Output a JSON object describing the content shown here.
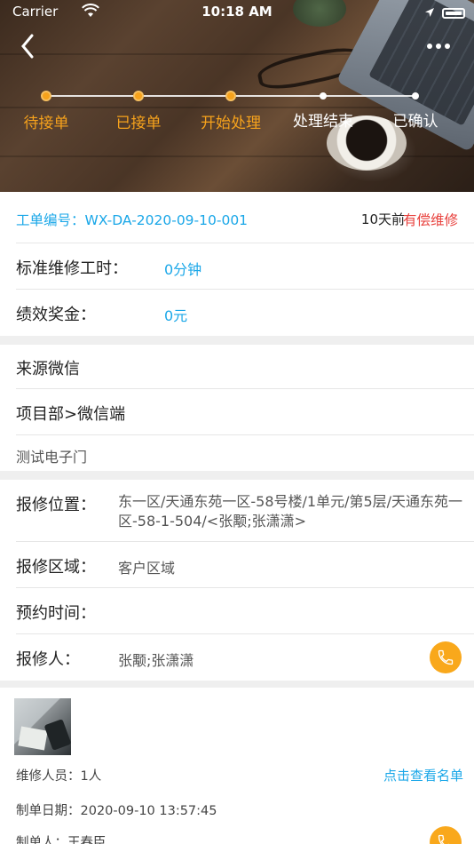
{
  "status_bar": {
    "carrier": "Carrier",
    "time": "10:18 AM"
  },
  "steps": [
    {
      "label": "待接单",
      "done": true
    },
    {
      "label": "已接单",
      "done": true
    },
    {
      "label": "开始处理",
      "done": true
    },
    {
      "label": "处理结束",
      "done": false
    },
    {
      "label": "已确认",
      "done": false
    }
  ],
  "order": {
    "number": "工单编号：WX-DA-2020-09-10-001",
    "ago": "10天前",
    "type": "有偿维修",
    "std_time_label": "标准维修工时：",
    "std_time_value": "0分钟",
    "bonus_label": "绩效奖金：",
    "bonus_value": "0元"
  },
  "source": {
    "channel": "来源微信",
    "dept": "项目部>微信端",
    "desc": "测试电子门"
  },
  "details": {
    "location_label": "报修位置：",
    "location_value": "东一区/天通东苑一区-58号楼/1单元/第5层/天通东苑一区-58-1-504/<张颙;张潇潇>",
    "area_label": "报修区域：",
    "area_value": "客户区域",
    "appointment_label": "预约时间：",
    "reporter_label": "报修人：",
    "reporter_value": "张颙;张潇潇"
  },
  "footer": {
    "staff": "维修人员：1人",
    "view_list": "点击查看名单",
    "created": "制单日期：2020-09-10 13:57:45",
    "creator": "制单人：王春臣"
  },
  "colors": {
    "accent_orange": "#f6a21c",
    "accent_blue": "#1aa7e8",
    "accent_red": "#e8413d"
  }
}
